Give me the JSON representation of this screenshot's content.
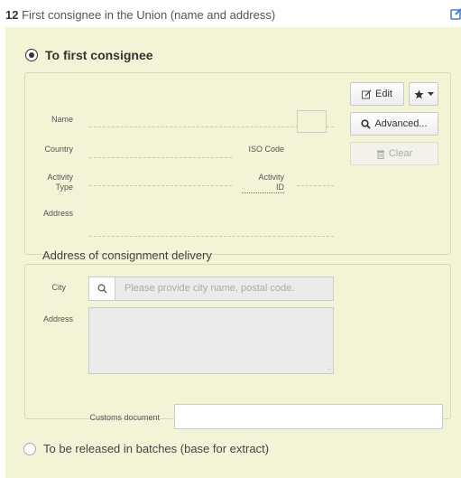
{
  "header": {
    "number": "12",
    "title": "First consignee in the Union (name and address)"
  },
  "consignee": {
    "radio_label": "To first consignee",
    "name_label": "Name",
    "country_label": "Country",
    "iso_label": "ISO Code",
    "activity_type_label_1": "Activity",
    "activity_type_label_2": "Type",
    "activity_id_label_1": "Activity",
    "activity_id_label_2": "ID",
    "address_label": "Address",
    "edit_label": "Edit",
    "advanced_label": "Advanced...",
    "clear_label": "Clear"
  },
  "delivery": {
    "title": "Address of consignment delivery",
    "city_label": "City",
    "city_placeholder": "Please provide city name, postal code.",
    "address_label": "Address"
  },
  "customs": {
    "label": "Customs document",
    "value": ""
  },
  "batches": {
    "radio_label": "To be released in batches (base for extract)"
  },
  "icons": [
    "edit-icon",
    "pencil-icon",
    "star-icon",
    "caret-down-icon",
    "search-icon",
    "trash-icon",
    "resize-handle-icon"
  ],
  "colors": {
    "panel_bg": "#f3f4d6",
    "accent_blue": "#3a7bd5"
  }
}
